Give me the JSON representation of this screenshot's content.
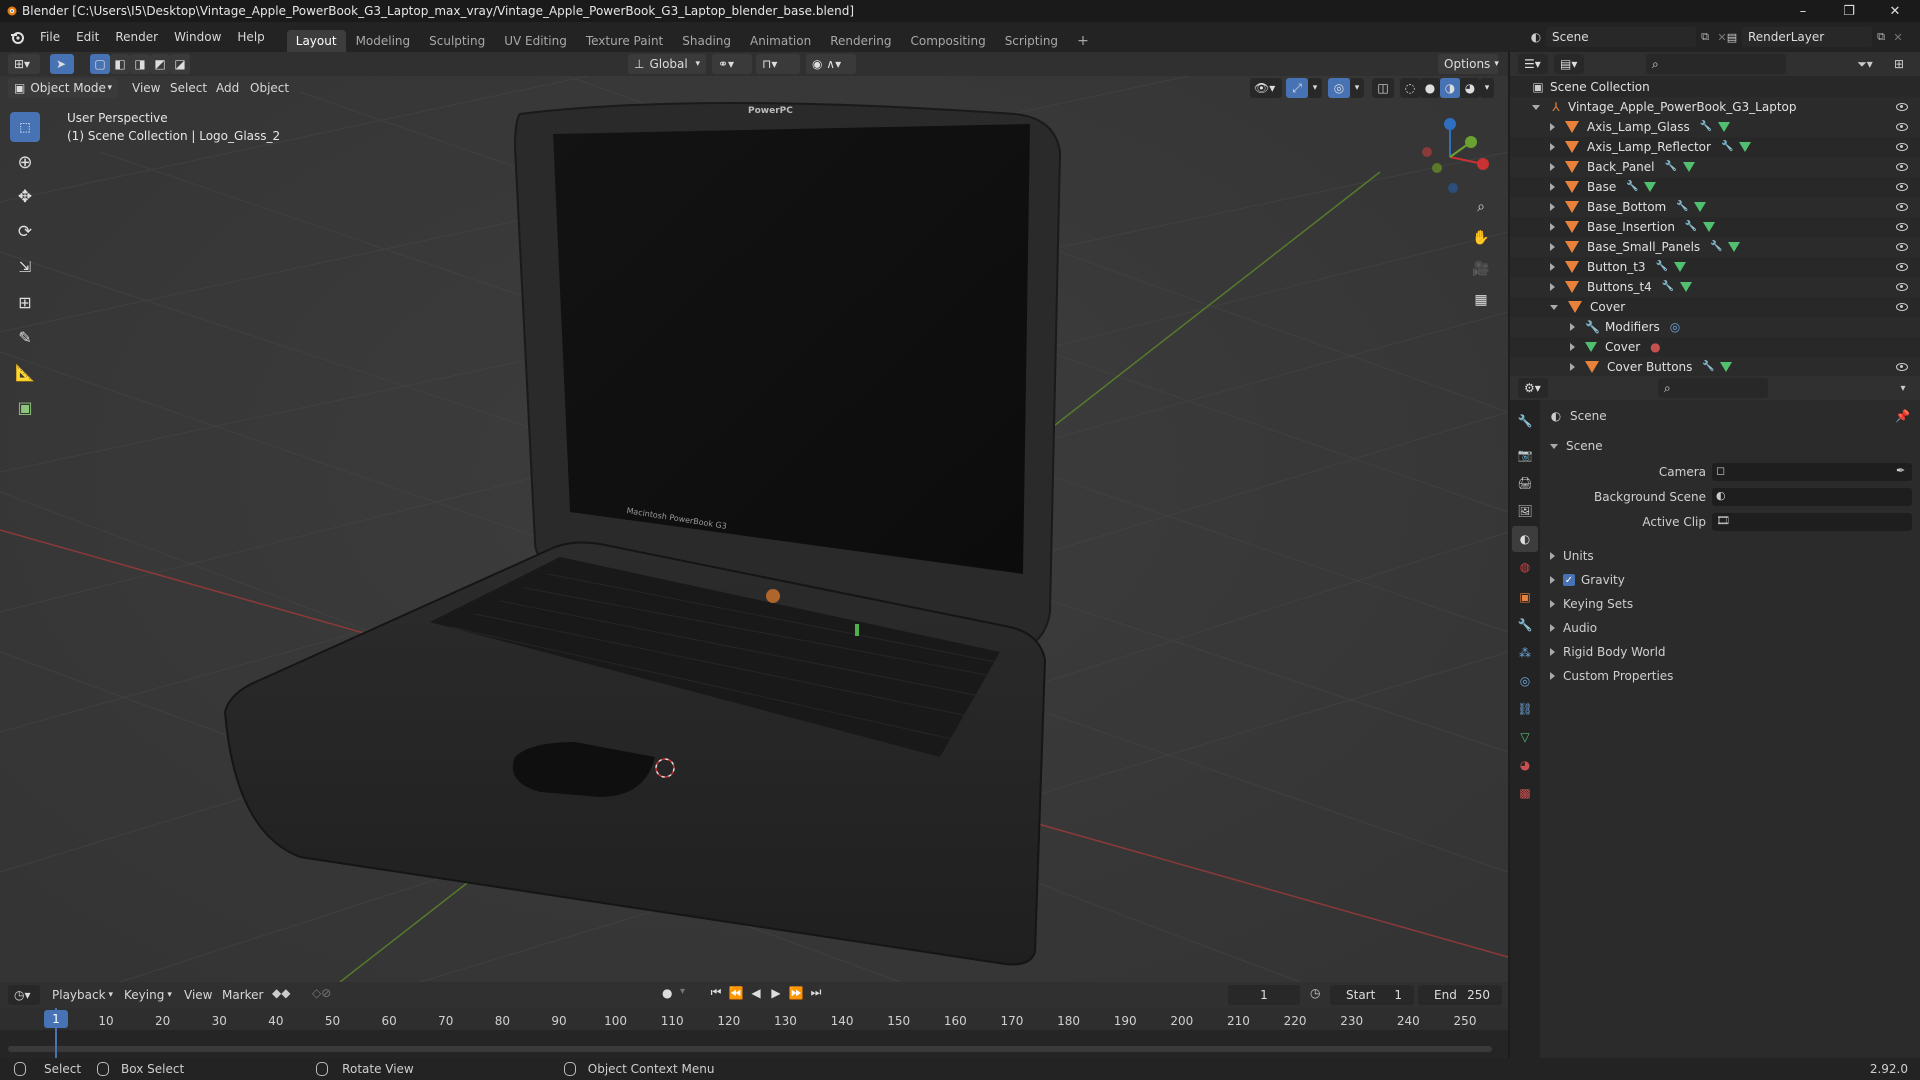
{
  "titlebar": {
    "title": "Blender [C:\\Users\\I5\\Desktop\\Vintage_Apple_PowerBook_G3_Laptop_max_vray/Vintage_Apple_PowerBook_G3_Laptop_blender_base.blend]",
    "minimize": "–",
    "maximize": "❐",
    "close": "✕"
  },
  "menubar": {
    "menus": [
      "File",
      "Edit",
      "Render",
      "Window",
      "Help"
    ],
    "workspaces": [
      "Layout",
      "Modeling",
      "Sculpting",
      "UV Editing",
      "Texture Paint",
      "Shading",
      "Animation",
      "Rendering",
      "Compositing",
      "Scripting"
    ],
    "add_workspace": "+",
    "scene_name": "Scene",
    "render_layer": "RenderLayer"
  },
  "viewport_header": {
    "orientation": "Global",
    "options_label": "Options",
    "mode": "Object Mode",
    "menus": [
      "View",
      "Select",
      "Add",
      "Object"
    ]
  },
  "viewport": {
    "perspective_label": "User Perspective",
    "collection_label": "(1) Scene Collection | Logo_Glass_2",
    "screen_logo": "PowerPC",
    "bezel_label": "Macintosh PowerBook G3"
  },
  "outliner": {
    "root": "Scene Collection",
    "collection": "Vintage_Apple_PowerBook_G3_Laptop",
    "items": [
      {
        "label": "Axis_Lamp_Glass",
        "indent": 0,
        "expanded": false
      },
      {
        "label": "Axis_Lamp_Reflector",
        "indent": 0,
        "expanded": false
      },
      {
        "label": "Back_Panel",
        "indent": 0,
        "expanded": false
      },
      {
        "label": "Base",
        "indent": 0,
        "expanded": false
      },
      {
        "label": "Base_Bottom",
        "indent": 0,
        "expanded": false
      },
      {
        "label": "Base_Insertion",
        "indent": 0,
        "expanded": false
      },
      {
        "label": "Base_Small_Panels",
        "indent": 0,
        "expanded": false
      },
      {
        "label": "Button_t3",
        "indent": 0,
        "expanded": false
      },
      {
        "label": "Buttons_t4",
        "indent": 0,
        "expanded": false
      },
      {
        "label": "Cover",
        "indent": 0,
        "expanded": true
      },
      {
        "label": "Modifiers",
        "indent": 1,
        "expanded": false
      },
      {
        "label": "Cover",
        "indent": 1,
        "expanded": false
      },
      {
        "label": "Cover Buttons",
        "indent": 1,
        "expanded": false
      }
    ]
  },
  "properties": {
    "breadcrumb": "Scene",
    "panel_title": "Scene",
    "fields": [
      {
        "label": "Camera"
      },
      {
        "label": "Background Scene"
      },
      {
        "label": "Active Clip"
      }
    ],
    "subpanels": [
      {
        "label": "Units",
        "checkbox": false
      },
      {
        "label": "Gravity",
        "checkbox": true
      },
      {
        "label": "Keying Sets",
        "checkbox": false
      },
      {
        "label": "Audio",
        "checkbox": false
      },
      {
        "label": "Rigid Body World",
        "checkbox": false
      },
      {
        "label": "Custom Properties",
        "checkbox": false
      }
    ]
  },
  "timeline": {
    "menus": [
      "Playback",
      "Keying",
      "View",
      "Marker"
    ],
    "current_frame": "1",
    "start_label": "Start",
    "start_value": "1",
    "end_label": "End",
    "end_value": "250",
    "ticks": [
      "10",
      "20",
      "30",
      "40",
      "50",
      "60",
      "70",
      "80",
      "90",
      "100",
      "110",
      "120",
      "130",
      "140",
      "150",
      "160",
      "170",
      "180",
      "190",
      "200",
      "210",
      "220",
      "230",
      "240",
      "250"
    ],
    "playhead": "1"
  },
  "statusbar": {
    "select": "Select",
    "box_select": "Box Select",
    "rotate_view": "Rotate View",
    "context_menu": "Object Context Menu",
    "version": "2.92.0"
  }
}
